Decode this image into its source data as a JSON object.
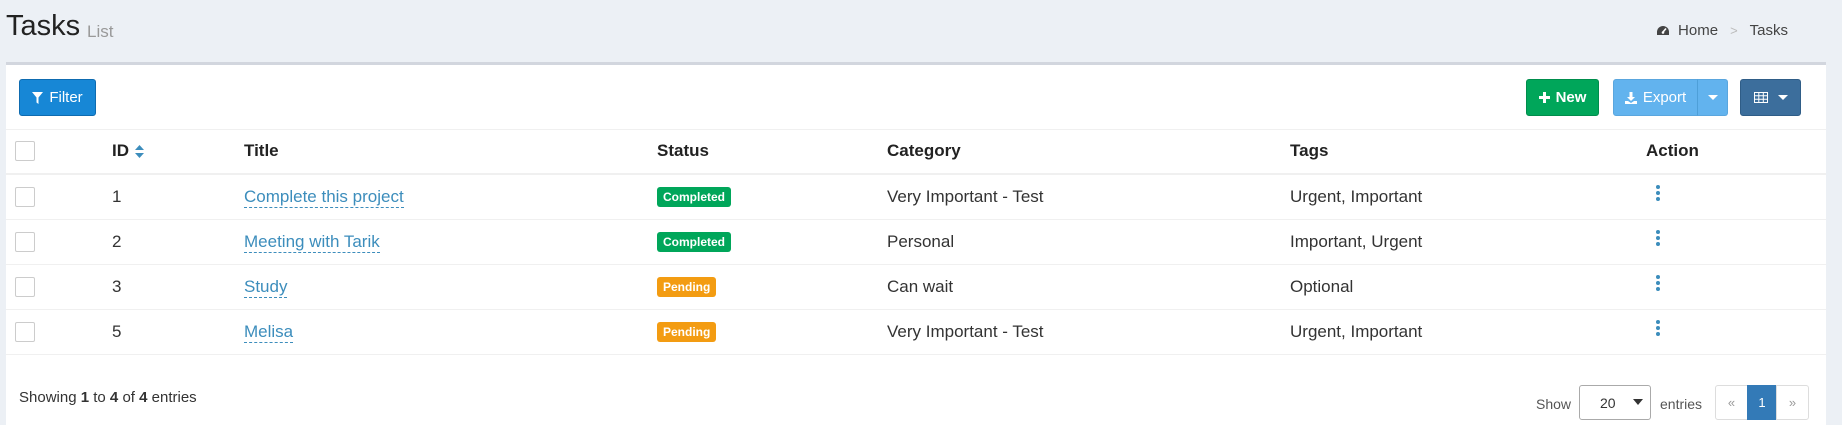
{
  "header": {
    "title": "Tasks",
    "subtitle": "List",
    "breadcrumb": {
      "home_icon": "dashboard-icon",
      "home": "Home",
      "current": "Tasks"
    }
  },
  "toolbar": {
    "filter_label": "Filter",
    "new_label": "New",
    "export_label": "Export",
    "columns_icon": "table-icon"
  },
  "table": {
    "columns": [
      "ID",
      "Title",
      "Status",
      "Category",
      "Tags",
      "Action"
    ],
    "rows": [
      {
        "id": "1",
        "title": "Complete this project",
        "status": "Completed",
        "category": "Very Important - Test",
        "tags": "Urgent, Important"
      },
      {
        "id": "2",
        "title": "Meeting with Tarik",
        "status": "Completed",
        "category": "Personal",
        "tags": "Important, Urgent"
      },
      {
        "id": "3",
        "title": "Study",
        "status": "Pending",
        "category": "Can wait",
        "tags": "Optional"
      },
      {
        "id": "5",
        "title": "Melisa",
        "status": "Pending",
        "category": "Very Important - Test",
        "tags": "Urgent, Important"
      }
    ]
  },
  "footer": {
    "showing_prefix": "Showing",
    "from": "1",
    "to_word": "to",
    "to": "4",
    "of_word": "of",
    "total": "4",
    "entries_word": "entries",
    "show_label": "Show",
    "page_size": "20",
    "entries_label": "entries",
    "prev": "«",
    "current_page": "1",
    "next": "»"
  },
  "colors": {
    "completed": "#00a65a",
    "pending": "#f39c12",
    "primary": "#1787d6",
    "success": "#00a65a",
    "export": "#62b3ee",
    "columns": "#3c6e9c",
    "link": "#3c8dbc"
  }
}
